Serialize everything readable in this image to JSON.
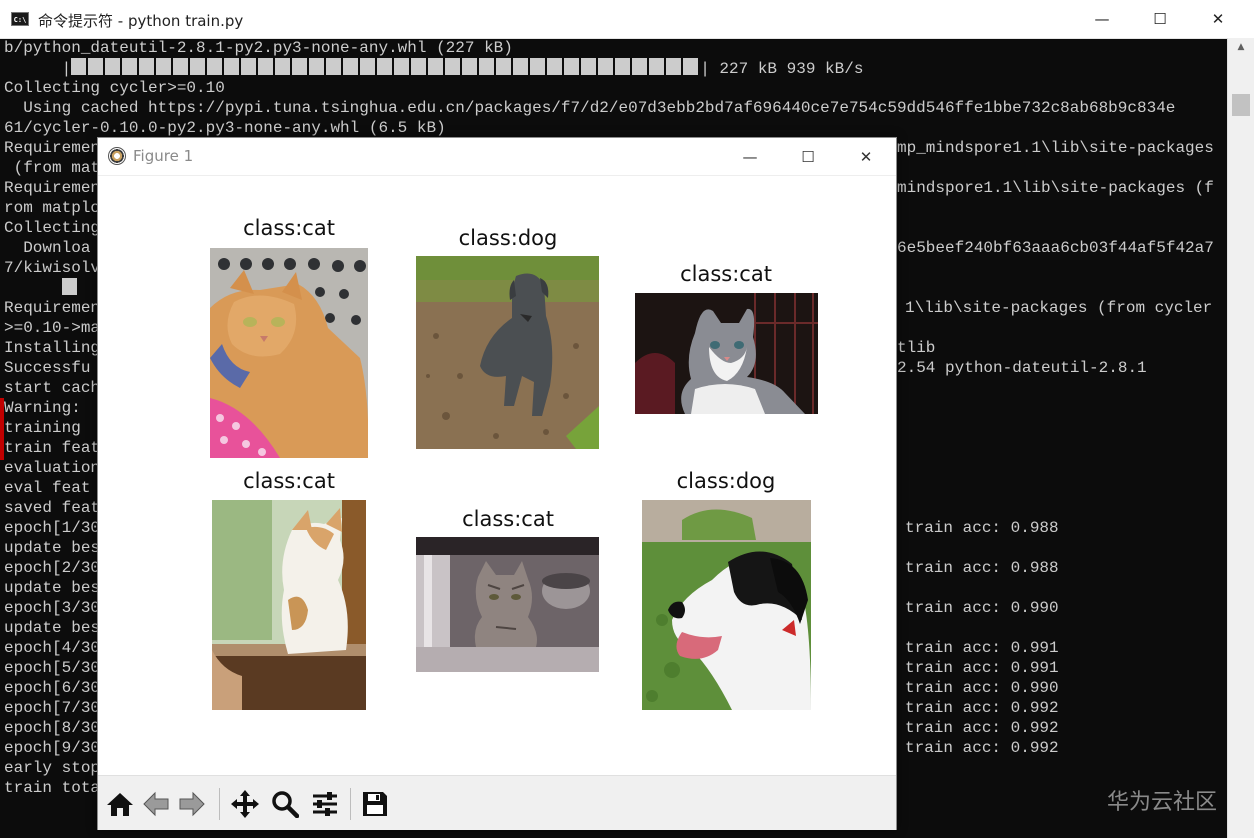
{
  "console": {
    "title": "命令提示符 - python  train.py",
    "window_controls": {
      "minimize": "—",
      "maximize": "☐",
      "close": "✕"
    },
    "lines": [
      "b/python_dateutil-2.8.1-py2.py3-none-any.whl (227 kB)",
      "Collecting cycler>=0.10",
      "  Using cached https://pypi.tuna.tsinghua.edu.cn/packages/f7/d2/e07d3ebb2bd7af696440ce7e754c59dd546ffe1bbe732c8ab68b9c834e",
      "61/cycler-0.10.0-py2.py3-none-any.whl (6.5 kB)",
      "Requiremen",
      " (from mat",
      "Requiremen",
      "rom matplo",
      "Collecting",
      "  Downloa",
      "7/kiwisolv",
      "Requiremen",
      ">=0.10->ma",
      "Installing",
      "Successfu",
      "start cach",
      "Warning: ",
      "training ",
      "train feat",
      "evaluation",
      "eval feat",
      "saved feat",
      "epoch[1/30",
      "update bes",
      "epoch[2/30",
      "update bes",
      "epoch[3/30",
      "update bes",
      "epoch[4/30",
      "epoch[5/30",
      "epoch[6/30",
      "epoch[7/30",
      "epoch[8/30",
      "epoch[9/30",
      "early stop",
      "train tota"
    ],
    "progress_suffix": "227 kB 939 kB/s",
    "progress_fraction": 1.0,
    "right_lines": [
      "mp_mindspore1.1\\lib\\site-packages",
      "mindspore1.1\\lib\\site-packages (f",
      "6e5beef240bf63aaa6cb03f44af5f42a7",
      "1\\lib\\site-packages (from cycler",
      "tlib",
      "2.54 python-dateutil-2.8.1",
      "train acc: 0.988",
      "train acc: 0.988",
      "train acc: 0.990",
      "train acc: 0.991",
      "train acc: 0.991",
      "train acc: 0.990",
      "train acc: 0.992",
      "train acc: 0.992",
      "train acc: 0.992"
    ],
    "scroll_up": "▲",
    "watermark": "华为云社区"
  },
  "figure": {
    "title": "Figure 1",
    "window_controls": {
      "minimize": "—",
      "maximize": "☐",
      "close": "✕"
    },
    "panels": [
      {
        "title": "class:cat",
        "subject": "orange tabby cat lying in carrier"
      },
      {
        "title": "class:dog",
        "subject": "grey dog sitting on gravel"
      },
      {
        "title": "class:cat",
        "subject": "grey and white kitten"
      },
      {
        "title": "class:cat",
        "subject": "calico cat sitting by window"
      },
      {
        "title": "class:cat",
        "subject": "tabby kitten under table"
      },
      {
        "title": "class:dog",
        "subject": "black and white dog on grass"
      }
    ],
    "toolbar": [
      {
        "name": "home",
        "icon": "home-icon"
      },
      {
        "name": "back",
        "icon": "arrow-left-icon"
      },
      {
        "name": "forward",
        "icon": "arrow-right-icon"
      },
      {
        "name": "pan",
        "icon": "move-icon"
      },
      {
        "name": "zoom",
        "icon": "magnifier-icon"
      },
      {
        "name": "configure-subplots",
        "icon": "sliders-icon"
      },
      {
        "name": "save",
        "icon": "floppy-disk-icon"
      }
    ]
  },
  "colors": {
    "console_bg": "#0c0c0c",
    "console_text": "#cccccc",
    "figure_bg": "#ffffff",
    "toolbar_bg": "#f0f0f0"
  }
}
